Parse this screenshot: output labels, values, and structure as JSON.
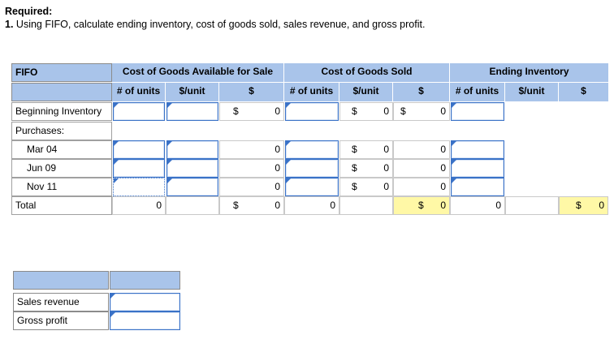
{
  "required": {
    "heading": "Required:",
    "number": "1.",
    "text": "Using FIFO, calculate ending inventory, cost of goods sold, sales revenue, and gross profit."
  },
  "table": {
    "corner_label": "FIFO",
    "groups": [
      "Cost of Goods Available for Sale",
      "Cost of Goods Sold",
      "Ending Inventory"
    ],
    "subheaders": {
      "available": [
        "# of units",
        "$/unit",
        "$"
      ],
      "sold": [
        "# of units",
        "$/unit",
        "$"
      ],
      "ending": [
        "# of units",
        "$/unit",
        "$"
      ]
    },
    "rows": {
      "beginning": {
        "label": "Beginning Inventory",
        "avail_dollar_sign": "$",
        "avail_total": "0",
        "sold_unit_sign": "$",
        "sold_unit": "0",
        "sold_dollar_sign": "$",
        "sold_total": "0"
      },
      "purchases": {
        "label": "Purchases:"
      },
      "mar": {
        "label": "Mar 04",
        "avail_total": "0",
        "sold_unit_sign": "$",
        "sold_unit": "0",
        "sold_total": "0"
      },
      "jun": {
        "label": "Jun 09",
        "avail_total": "0",
        "sold_unit_sign": "$",
        "sold_unit": "0",
        "sold_total": "0"
      },
      "nov": {
        "label": "Nov 11",
        "avail_total": "0",
        "sold_unit_sign": "$",
        "sold_unit": "0",
        "sold_total": "0"
      },
      "total": {
        "label": "Total",
        "avail_units": "0",
        "avail_dollar_sign": "$",
        "avail_total": "0",
        "sold_units": "0",
        "sold_dollar_sign": "$",
        "sold_total": "0",
        "end_units": "0",
        "end_dollar_sign": "$",
        "end_total": "0"
      }
    }
  },
  "summary": {
    "rows": [
      "Sales revenue",
      "Gross profit"
    ]
  },
  "colors": {
    "header_blue": "#a9c4ea",
    "input_border": "#3a72c7",
    "highlight_yellow": "#fff8a6"
  }
}
